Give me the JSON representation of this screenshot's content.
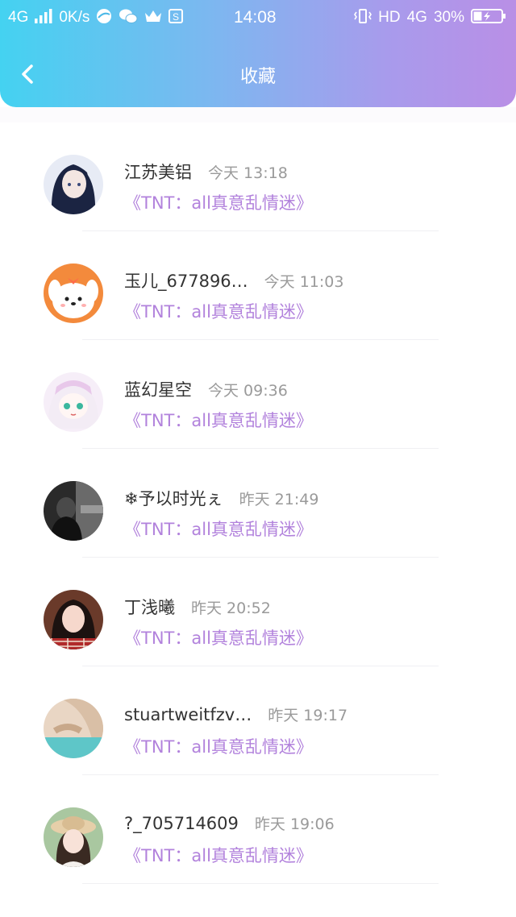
{
  "status_bar": {
    "network": "4G",
    "speed": "0K/s",
    "time": "14:08",
    "hd": "HD",
    "net_type": "4G",
    "battery": "30%",
    "battery_level": 0.3
  },
  "nav": {
    "title": "收藏",
    "back_icon": "chevron-left-icon"
  },
  "favorites": [
    {
      "username": "江苏美铝",
      "time": "今天 13:18",
      "book": "《TNT：all真意乱情迷》"
    },
    {
      "username": "玉儿_677896…",
      "time": "今天 11:03",
      "book": "《TNT：all真意乱情迷》"
    },
    {
      "username": "蓝幻星空",
      "time": "今天 09:36",
      "book": "《TNT：all真意乱情迷》"
    },
    {
      "username": "❄予以时光ぇ",
      "time": "昨天 21:49",
      "book": "《TNT：all真意乱情迷》"
    },
    {
      "username": "丁浅曦",
      "time": "昨天 20:52",
      "book": "《TNT：all真意乱情迷》"
    },
    {
      "username": "stuartweitfzv…",
      "time": "昨天 19:17",
      "book": "《TNT：all真意乱情迷》"
    },
    {
      "username": "?_705714609",
      "time": "昨天 19:06",
      "book": "《TNT：all真意乱情迷》"
    }
  ],
  "colors": {
    "header_gradient_start": "#44d2f1",
    "header_gradient_end": "#b98fe6",
    "book_title": "#b282dc",
    "username": "#333333",
    "time": "#9a9a9a"
  }
}
